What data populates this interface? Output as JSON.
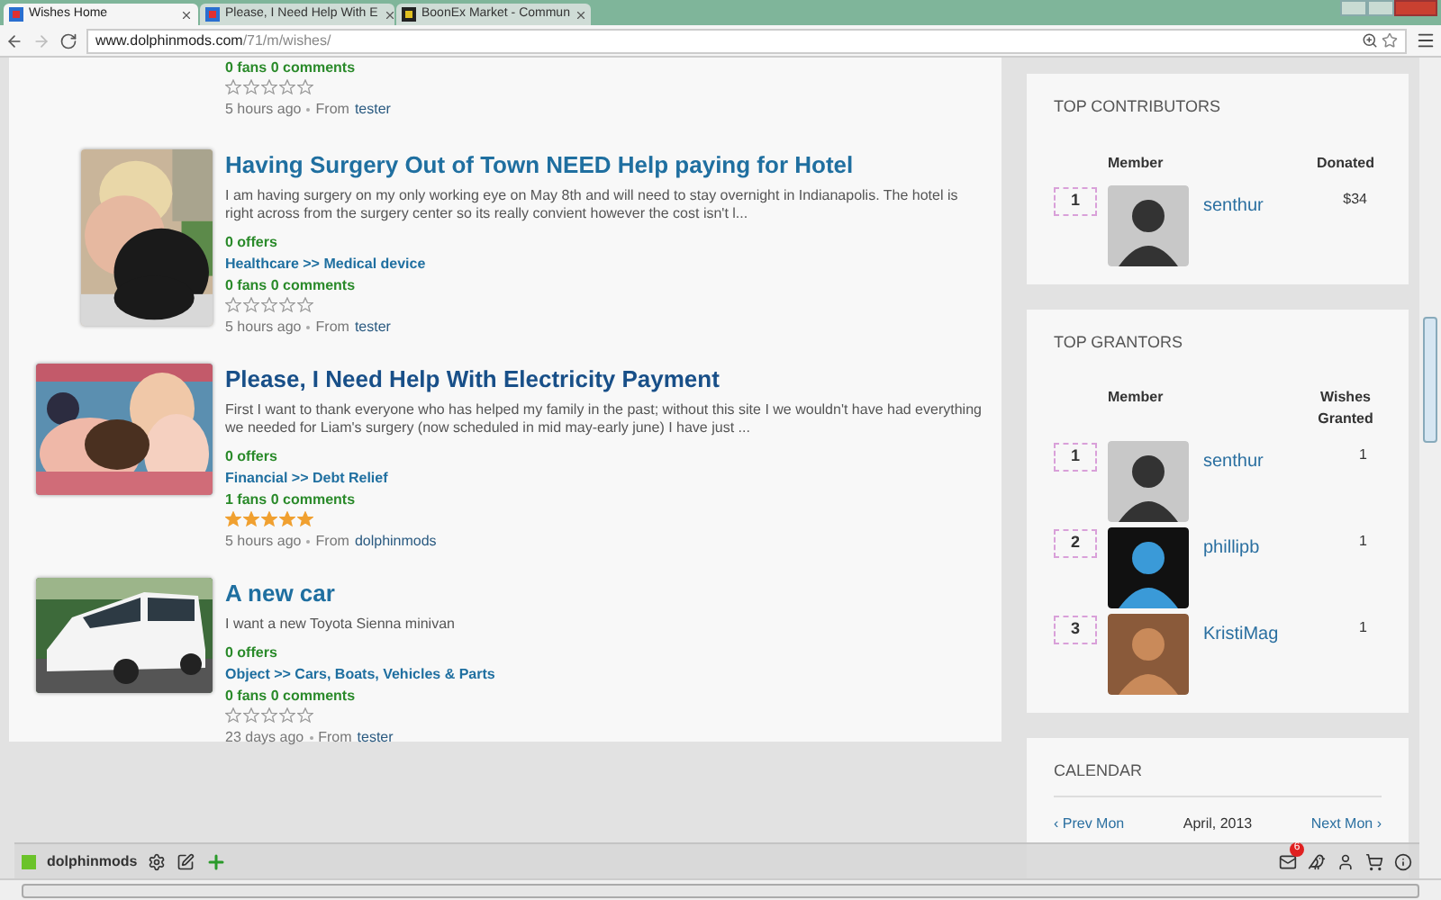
{
  "browser": {
    "tabs": [
      {
        "title": "Wishes Home",
        "selected": true
      },
      {
        "title": "Please, I Need Help With E",
        "selected": false
      },
      {
        "title": "BoonEx Market - Commun",
        "selected": false
      }
    ],
    "url": {
      "host": "www.dolphinmods.com",
      "path": "/71/m/wishes/"
    }
  },
  "wishes": [
    {
      "fans": "0 fans 0 comments",
      "stars": 0,
      "time": "5 hours ago",
      "from": "From",
      "author": "tester"
    },
    {
      "kind": "picture",
      "title": "Having Surgery Out of Town NEED Help paying for Hotel",
      "description": "I am having surgery on my only working eye on May 8th and will need to stay overnight in Indianapolis. The hotel is right across from the surgery center so its really convient however the cost isn't l...",
      "offers": "0 offers",
      "category": "Healthcare >> Medical device",
      "fans": "0 fans 0 comments",
      "stars": 0,
      "time": "5 hours ago",
      "from": "From",
      "author": "tester"
    },
    {
      "kind": "picture",
      "title": "Please, I Need Help With Electricity Payment",
      "description": "First I want to thank everyone who has helped my family in the past; without this site I we wouldn't have had everything we needed for Liam's surgery (now scheduled in mid may-early june) I have just ...",
      "offers": "0 offers",
      "category": "Financial >> Debt Relief",
      "fans": "1 fans 0 comments",
      "stars": 5,
      "time": "5 hours ago",
      "from": "From",
      "author": "dolphinmods"
    },
    {
      "kind": "picture",
      "title": "A new car",
      "description": "I want a new Toyota Sienna minivan",
      "offers": "0 offers",
      "category": "Object >> Cars, Boats, Vehicles & Parts",
      "fans": "0 fans 0 comments",
      "stars": 0,
      "time": "23 days ago",
      "from": "From",
      "author": "tester"
    }
  ],
  "top_contributors": {
    "title": "TOP CONTRIBUTORS",
    "columns": [
      "Member",
      "Donated"
    ],
    "rows": [
      {
        "rank": "1",
        "name": "senthur",
        "value": "$34"
      }
    ]
  },
  "top_grantors": {
    "title": "TOP GRANTORS",
    "columns": [
      "Member",
      "Wishes Granted"
    ],
    "rows": [
      {
        "rank": "1",
        "name": "senthur",
        "value": "1"
      },
      {
        "rank": "2",
        "name": "phillipb",
        "value": "1"
      },
      {
        "rank": "3",
        "name": "KristiMag",
        "value": "1"
      }
    ]
  },
  "calendar": {
    "title": "CALENDAR",
    "prev": "‹ Prev Mon",
    "month": "April, 2013",
    "next": "Next Mon ›"
  },
  "toolbar": {
    "user": "dolphinmods",
    "mail_count": "6"
  }
}
